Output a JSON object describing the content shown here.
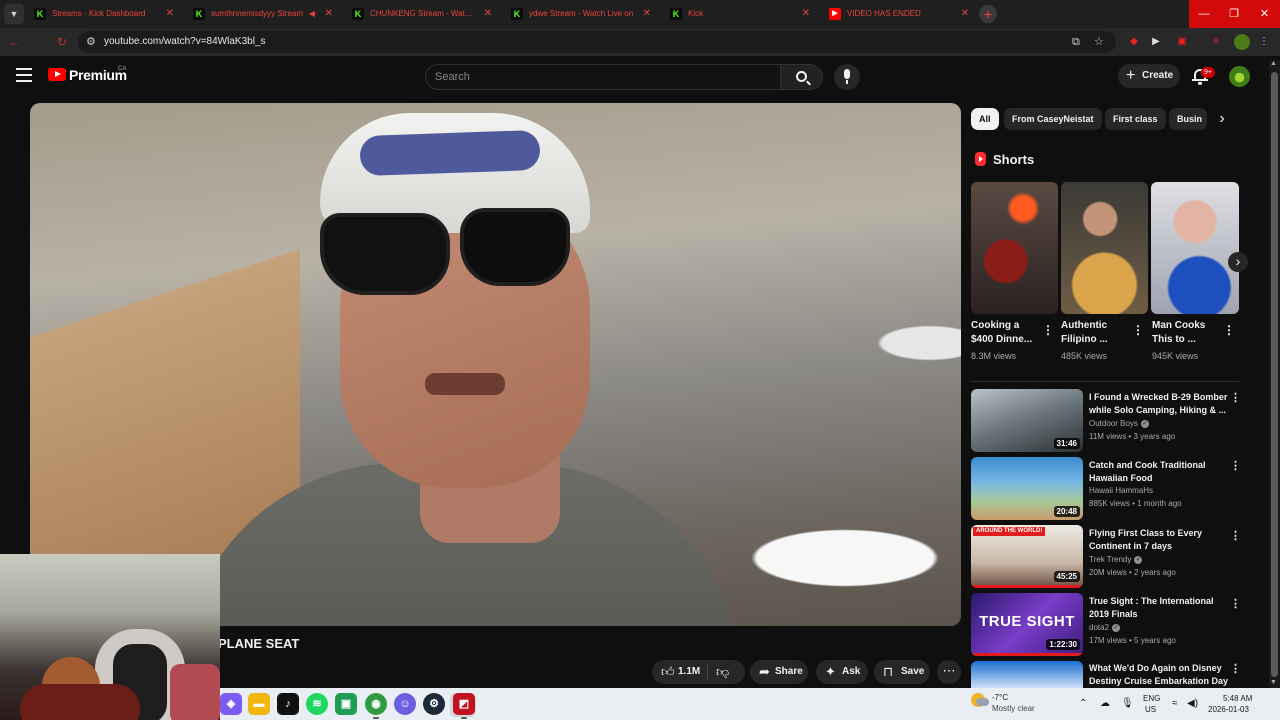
{
  "browser": {
    "tabs": [
      {
        "title": "Streams - Kick Dashboard",
        "favicon": "kick-icon"
      },
      {
        "title": "sumthnnemisdyyy Stream",
        "favicon": "kick-icon",
        "muted": true
      },
      {
        "title": "CHUNKENG Stream - Watch Li",
        "favicon": "kick-icon"
      },
      {
        "title": "ydwe Stream - Watch Live on",
        "favicon": "kick-icon"
      },
      {
        "title": "Kick",
        "favicon": "kick-icon"
      },
      {
        "title": "VIDEO HAS ENDED",
        "favicon": "youtube-icon"
      }
    ],
    "url": "youtube.com/watch?v=84WlaK3bl_s",
    "accent_color": "#d40a0a"
  },
  "youtube": {
    "brand": "Premium",
    "region": "CA",
    "search_placeholder": "Search",
    "create_label": "Create",
    "notifications": "9+"
  },
  "video": {
    "title": "PLANE SEAT",
    "likes": "1.1M",
    "share_label": "Share",
    "ask_label": "Ask",
    "save_label": "Save"
  },
  "chips": [
    "All",
    "From CaseyNeistat",
    "First class",
    "Busin"
  ],
  "shorts": {
    "heading": "Shorts",
    "items": [
      {
        "title": "Cooking a $400 Dinne...",
        "views": "8.3M views"
      },
      {
        "title": "Authentic Filipino ...",
        "views": "485K views"
      },
      {
        "title": "Man Cooks This to ...",
        "views": "945K views"
      }
    ]
  },
  "recommendations": [
    {
      "title": "I Found a Wrecked B-29 Bomber while Solo Camping, Hiking & ...",
      "channel": "Outdoor Boys",
      "verified": true,
      "meta": "11M views • 3 years ago",
      "duration": "31:46"
    },
    {
      "title": "Catch and Cook Traditional Hawaiian Food",
      "channel": "Hawaii HammaHs",
      "verified": false,
      "meta": "885K views • 1 month ago",
      "duration": "20:48"
    },
    {
      "title": "Flying First Class to Every Continent in 7 days",
      "channel": "Trek Trendy",
      "verified": true,
      "meta": "20M views • 2 years ago",
      "duration": "45:25",
      "tag": "AROUND THE WORLD!"
    },
    {
      "title": "True Sight : The International 2019 Finals",
      "channel": "dota2",
      "verified": true,
      "meta": "17M views • 5 years ago",
      "duration": "1:22:30",
      "thumb_text": "TRUE SIGHT"
    },
    {
      "title": "What We'd Do Again on Disney Destiny Cruise Embarkation Day",
      "channel": "",
      "verified": false,
      "meta": "",
      "duration": ""
    }
  ],
  "taskbar": {
    "weather_temp": "-7°C",
    "weather_desc": "Mostly clear",
    "lang_line1": "ENG",
    "lang_line2": "US",
    "time": "5:48 AM",
    "date": "2026-01-03"
  }
}
